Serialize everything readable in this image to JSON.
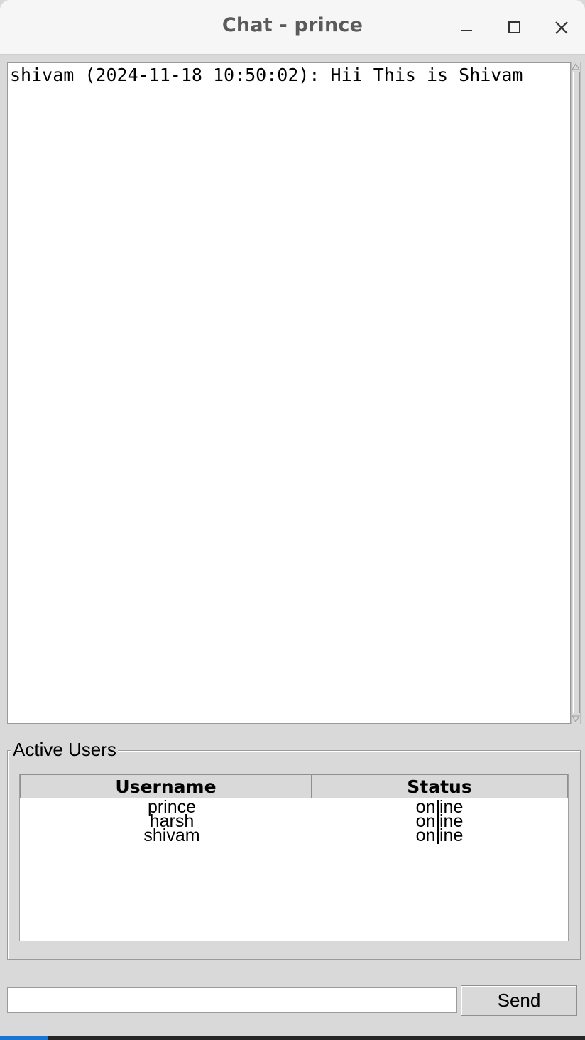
{
  "window": {
    "title": "Chat - prince",
    "controls": [
      "minimize-icon",
      "maximize-icon",
      "close-icon"
    ]
  },
  "chat": {
    "messages": [
      "shivam (2024-11-18 10:50:02): Hii This is Shivam"
    ]
  },
  "active_users": {
    "label": "Active Users",
    "columns": [
      "Username",
      "Status"
    ],
    "rows": [
      {
        "username": "prince",
        "status": "online"
      },
      {
        "username": "harsh",
        "status": "online"
      },
      {
        "username": "shivam",
        "status": "online"
      }
    ]
  },
  "composer": {
    "input_value": "",
    "send_label": "Send"
  }
}
